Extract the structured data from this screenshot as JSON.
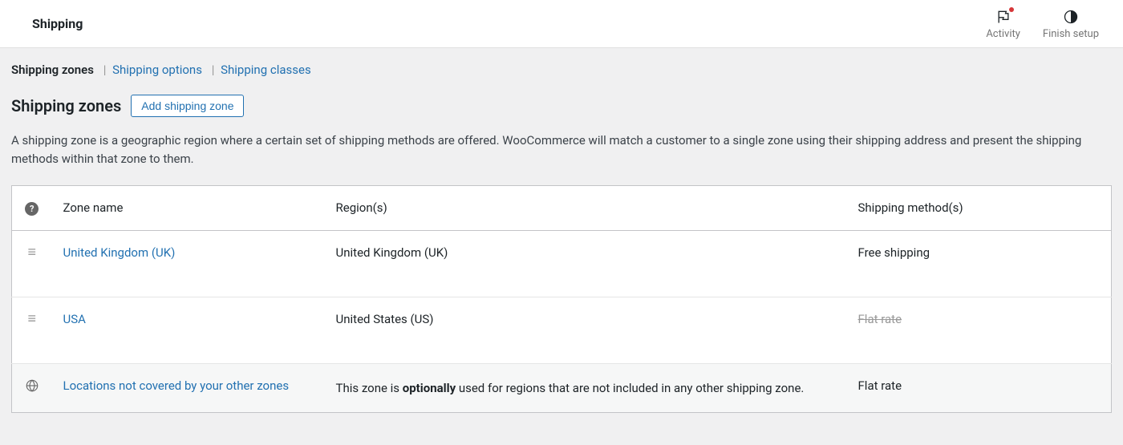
{
  "header": {
    "title": "Shipping",
    "actions": {
      "activity": "Activity",
      "finish_setup": "Finish setup"
    }
  },
  "tabs": {
    "zones": "Shipping zones",
    "options": "Shipping options",
    "classes": "Shipping classes"
  },
  "section": {
    "title": "Shipping zones",
    "add_button": "Add shipping zone",
    "description": "A shipping zone is a geographic region where a certain set of shipping methods are offered. WooCommerce will match a customer to a single zone using their shipping address and present the shipping methods within that zone to them."
  },
  "table": {
    "headers": {
      "name": "Zone name",
      "region": "Region(s)",
      "method": "Shipping method(s)"
    },
    "rows": [
      {
        "name": "United Kingdom (UK)",
        "region": "United Kingdom (UK)",
        "method": "Free shipping",
        "method_strike": false
      },
      {
        "name": "USA",
        "region": "United States (US)",
        "method": "Flat rate",
        "method_strike": true
      }
    ],
    "default_row": {
      "name": "Locations not covered by your other zones",
      "region_pre": "This zone is ",
      "region_bold": "optionally",
      "region_post": " used for regions that are not included in any other shipping zone.",
      "method": "Flat rate"
    }
  }
}
